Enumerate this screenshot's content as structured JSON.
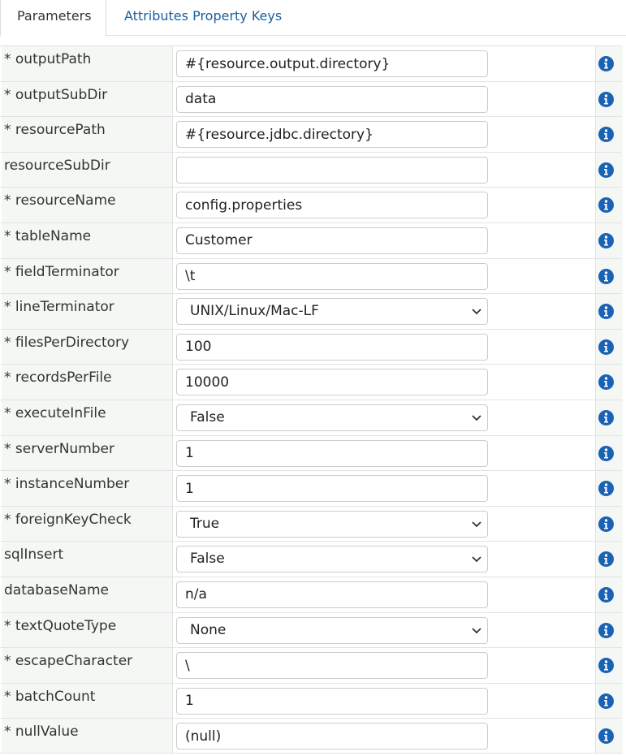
{
  "tabs": [
    {
      "label": "Parameters",
      "active": true
    },
    {
      "label": "Attributes Property Keys",
      "active": false
    }
  ],
  "colors": {
    "accent": "#1a62b3",
    "tab_link": "#1a5e9e",
    "label_bg": "#f4f7f4"
  },
  "icons": {
    "info": "info-circle-icon",
    "dropdown": "chevron-down-icon"
  },
  "rows": [
    {
      "label": "* outputPath",
      "type": "input",
      "value": "#{resource.output.directory}"
    },
    {
      "label": "* outputSubDir",
      "type": "input",
      "value": "data"
    },
    {
      "label": "* resourcePath",
      "type": "input",
      "value": "#{resource.jdbc.directory}"
    },
    {
      "label": "resourceSubDir",
      "type": "input",
      "value": ""
    },
    {
      "label": "* resourceName",
      "type": "input",
      "value": "config.properties"
    },
    {
      "label": "* tableName",
      "type": "input",
      "value": "Customer"
    },
    {
      "label": "* fieldTerminator",
      "type": "input",
      "value": "\\t"
    },
    {
      "label": "* lineTerminator",
      "type": "select",
      "value": "UNIX/Linux/Mac-LF"
    },
    {
      "label": "* filesPerDirectory",
      "type": "input",
      "value": "100"
    },
    {
      "label": "* recordsPerFile",
      "type": "input",
      "value": "10000"
    },
    {
      "label": "* executeInFile",
      "type": "select",
      "value": "False"
    },
    {
      "label": "* serverNumber",
      "type": "input",
      "value": "1"
    },
    {
      "label": "* instanceNumber",
      "type": "input",
      "value": "1"
    },
    {
      "label": "* foreignKeyCheck",
      "type": "select",
      "value": "True"
    },
    {
      "label": "sqlInsert",
      "type": "select",
      "value": "False"
    },
    {
      "label": "databaseName",
      "type": "input",
      "value": "n/a"
    },
    {
      "label": "* textQuoteType",
      "type": "select",
      "value": "None"
    },
    {
      "label": "* escapeCharacter",
      "type": "input",
      "value": "\\"
    },
    {
      "label": "* batchCount",
      "type": "input",
      "value": "1"
    },
    {
      "label": "* nullValue",
      "type": "input",
      "value": "(null)"
    }
  ]
}
